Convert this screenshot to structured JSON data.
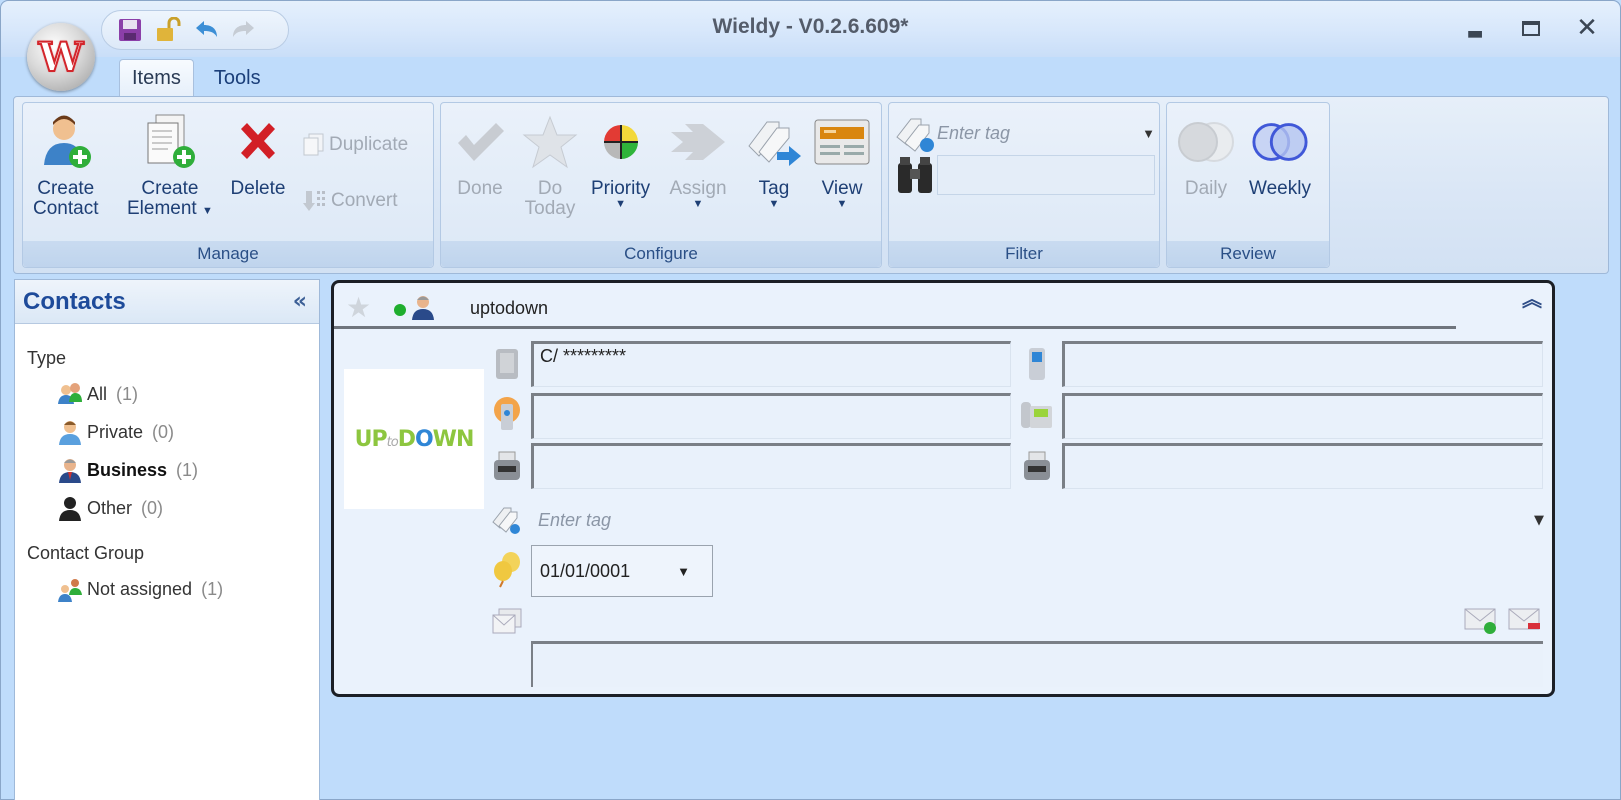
{
  "window": {
    "title": "Wieldy - V0.2.6.609*",
    "app_icon": "wieldy-orb-icon",
    "app_icon_letter": "W",
    "quick_access": [
      {
        "name": "save-icon",
        "glyph": "💾"
      },
      {
        "name": "unlock-icon",
        "glyph": "🔓"
      },
      {
        "name": "undo-icon",
        "glyph": "↶"
      },
      {
        "name": "redo-icon",
        "glyph": "↷"
      }
    ],
    "controls": {
      "minimize": "_",
      "maximize": "▭",
      "close": "✕"
    }
  },
  "tabs": [
    {
      "label": "Items",
      "active": true
    },
    {
      "label": "Tools",
      "active": false
    }
  ],
  "ribbon": {
    "manage": {
      "label": "Manage",
      "create_contact": "Create Contact",
      "create_contact_l1": "Create",
      "create_contact_l2": "Contact",
      "create_element_l1": "Create",
      "create_element_l2": "Element",
      "delete": "Delete",
      "duplicate": "Duplicate",
      "convert": "Convert"
    },
    "configure": {
      "label": "Configure",
      "done": "Done",
      "do_today_l1": "Do",
      "do_today_l2": "Today",
      "priority": "Priority",
      "assign": "Assign",
      "tag": "Tag",
      "view": "View"
    },
    "filter": {
      "label": "Filter",
      "tag_placeholder": "Enter tag",
      "search_value": ""
    },
    "review": {
      "label": "Review",
      "daily": "Daily",
      "weekly": "Weekly"
    }
  },
  "sidebar": {
    "title": "Contacts",
    "collapse_glyph": "«",
    "type_label": "Type",
    "types": [
      {
        "label": "All",
        "count": "(1)",
        "bold": false
      },
      {
        "label": "Private",
        "count": "(0)",
        "bold": false
      },
      {
        "label": "Business",
        "count": "(1)",
        "bold": true
      },
      {
        "label": "Other",
        "count": "(0)",
        "bold": false
      }
    ],
    "group_label": "Contact Group",
    "groups": [
      {
        "label": "Not assigned",
        "count": "(1)"
      }
    ]
  },
  "contact": {
    "name": "uptodown",
    "status_color": "#1fae2e",
    "logo": {
      "up": "UP",
      "to": "to",
      "d": "D",
      "o": "O",
      "wn": "WN"
    },
    "address": "C/ *********",
    "web": "",
    "fax": "",
    "mobile": "",
    "phone": "",
    "fax2": "",
    "tag_placeholder": "Enter tag",
    "date": "01/01/0001",
    "notes": "",
    "collapse_glyph": "⌃"
  },
  "colors": {
    "accent_text": "#1e3f75",
    "title_blue": "#1e4b9a",
    "background": "#bfdcfb"
  }
}
